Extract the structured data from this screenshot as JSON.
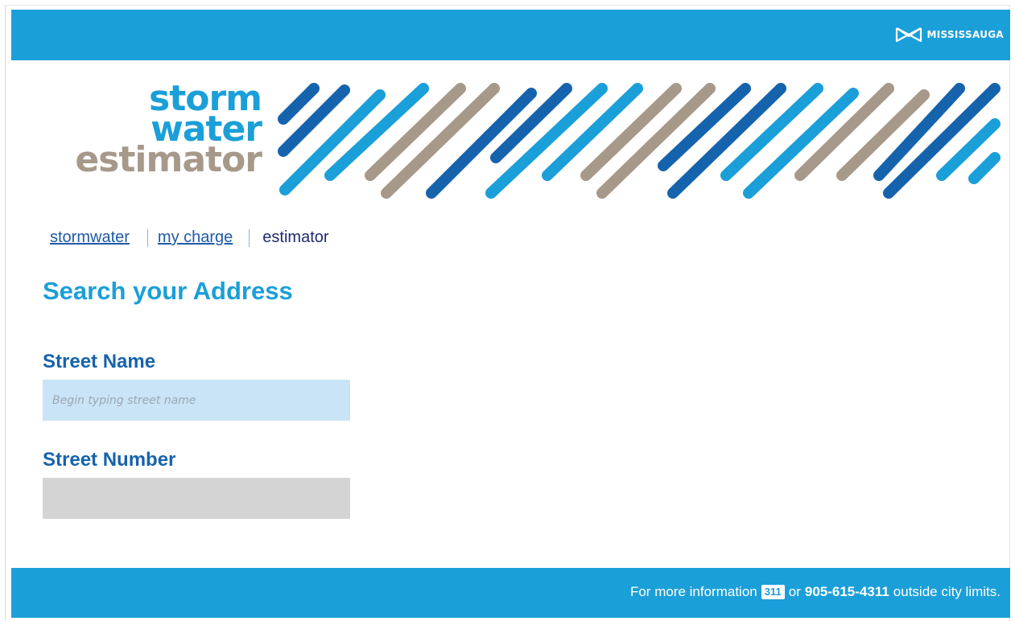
{
  "header": {
    "brand_name": "MISSISSAUGA",
    "brand_icon": "mississauga-logo-icon",
    "color": "#1b9fd8"
  },
  "logo": {
    "line1": "storm",
    "line2": "water",
    "line3": "estimator",
    "colors": {
      "blue": "#1b9fd8",
      "dark_blue": "#1663ad",
      "taupe": "#a7998a"
    }
  },
  "nav": {
    "items": [
      {
        "label": "stormwater",
        "link": true
      },
      {
        "label": "my charge",
        "link": true
      },
      {
        "label": "estimator",
        "link": false
      }
    ]
  },
  "form": {
    "title": "Search your Address",
    "street_name": {
      "label": "Street Name",
      "placeholder": "Begin typing street name",
      "value": ""
    },
    "street_number": {
      "label": "Street Number",
      "value": "",
      "disabled": true
    }
  },
  "footer": {
    "prefix": "For more information",
    "badge": "311",
    "or": "or",
    "phone": "905-615-4311",
    "suffix": "outside city limits."
  }
}
